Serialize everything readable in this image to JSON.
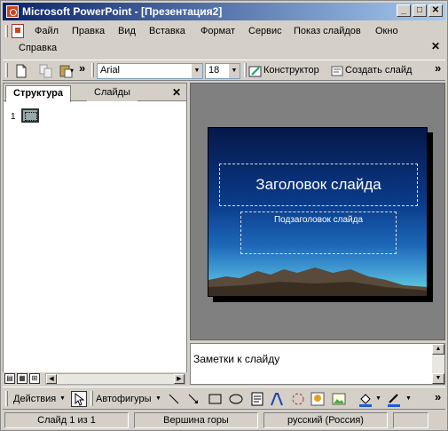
{
  "window": {
    "title": "Microsoft PowerPoint - [Презентация2]"
  },
  "menu": {
    "items": [
      "Файл",
      "Правка",
      "Вид",
      "Вставка",
      "Формат",
      "Сервис",
      "Показ слайдов",
      "Окно",
      "Справка"
    ]
  },
  "toolbar": {
    "font_name": "Arial",
    "font_size": "18",
    "designer_label": "Конструктор",
    "new_slide_label": "Создать слайд"
  },
  "left_pane": {
    "tabs": [
      "Структура",
      "Слайды"
    ],
    "slide_number": "1"
  },
  "slide": {
    "title_placeholder": "Заголовок слайда",
    "subtitle_placeholder": "Подзаголовок слайда"
  },
  "notes": {
    "placeholder": "Заметки к слайду"
  },
  "drawing": {
    "actions_label": "Действия",
    "autoshapes_label": "Автофигуры"
  },
  "status": {
    "slide_info": "Слайд 1 из 1",
    "design": "Вершина горы",
    "language": "русский (Россия)"
  }
}
